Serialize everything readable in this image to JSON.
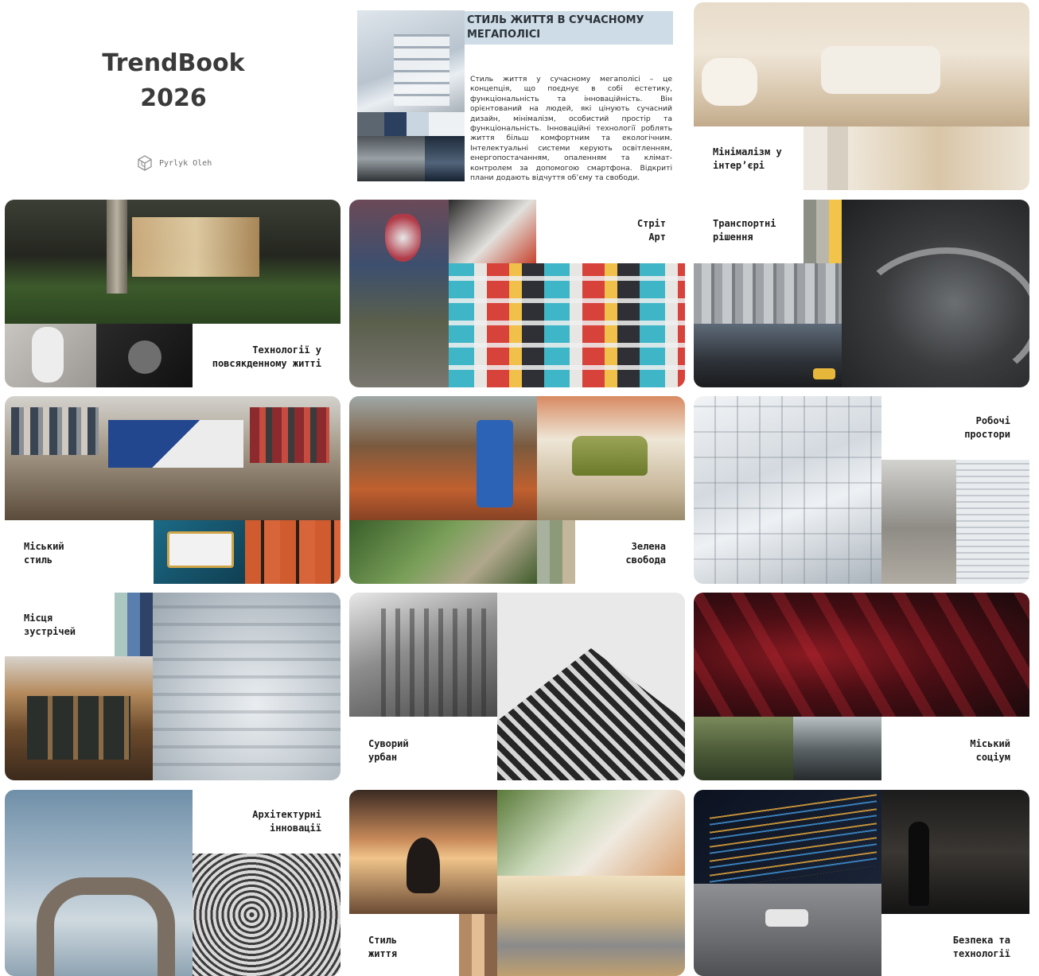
{
  "cover": {
    "title_line1": "TrendBook",
    "title_line2": "2026",
    "author": "Pyrlyk Oleh",
    "logo_icon": "cube-logo-icon"
  },
  "intro": {
    "title": "СТИЛЬ ЖИТТЯ В СУЧАСНОМУ МЕГАПОЛІСІ",
    "body": "Стиль життя у сучасному мегаполісі – це концепція, що поєднує в собі естетику, функціональність та інноваційність. Він орієнтований на людей, які цінують сучасний дизайн, мінімалізм, особистий простір та функціональність. Інноваційні технології роблять життя більш комфортним та екологічним. Інтелектуальні системи керують освітленням, енергопостачанням, опаленням та клімат-контролем за допомогою смартфона. Відкриті плани додають відчуття обʼєму та свободи."
  },
  "boards": [
    {
      "label": "Мінімалізм у\nінтер’єрі"
    },
    {
      "label": "Технології у\nповсякденному житті"
    },
    {
      "label": "Стріт\nАрт"
    },
    {
      "label": "Транспортні\nрішення"
    },
    {
      "label": "Міський\nстиль"
    },
    {
      "label": "Зелена\nсвобода"
    },
    {
      "label": "Робочі\nпростори"
    },
    {
      "label": "Місця\nзустрічей"
    },
    {
      "label": "Суворий\nурбан"
    },
    {
      "label": "Міський\nсоціум"
    },
    {
      "label": "Архітектурні\nінновації"
    },
    {
      "label": "Стиль\nжиття"
    },
    {
      "label": "Безпека та\nтехнології"
    }
  ],
  "colors": {
    "intro_header_bg": "#cddce6",
    "text": "#1b1b1b"
  }
}
